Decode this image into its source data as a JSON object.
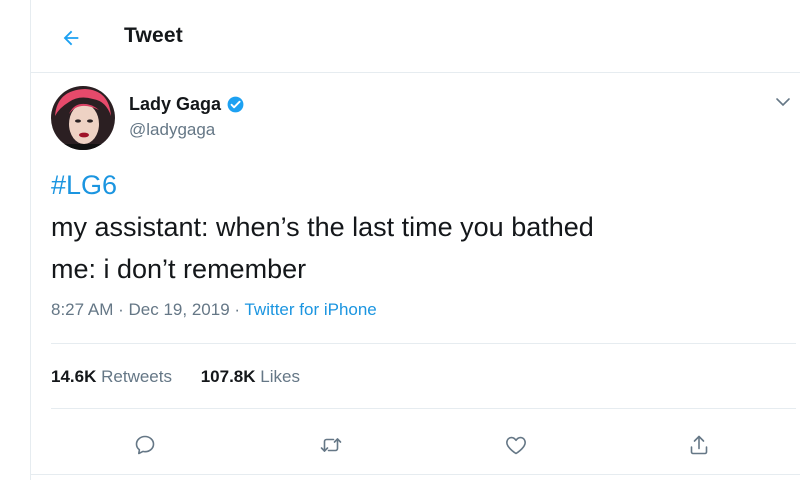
{
  "header": {
    "title": "Tweet",
    "back_icon": "arrow-left-icon"
  },
  "tweet": {
    "author": {
      "name": "Lady Gaga",
      "handle": "@ladygaga",
      "verified": true
    },
    "hashtag": "#LG6",
    "lines": [
      "my assistant: when’s the last time you bathed",
      "me: i don’t remember"
    ],
    "time": "8:27 AM",
    "date": "Dec 19, 2019",
    "source": "Twitter for iPhone",
    "separator": "·"
  },
  "stats": {
    "retweets": {
      "count": "14.6K",
      "label": "Retweets"
    },
    "likes": {
      "count": "107.8K",
      "label": "Likes"
    }
  },
  "actions": [
    "reply-icon",
    "retweet-icon",
    "like-icon",
    "share-icon"
  ],
  "colors": {
    "accent": "#1da1f2",
    "link": "#1b95e0",
    "text": "#14171a",
    "muted": "#657786",
    "border": "#e6ecf0"
  }
}
